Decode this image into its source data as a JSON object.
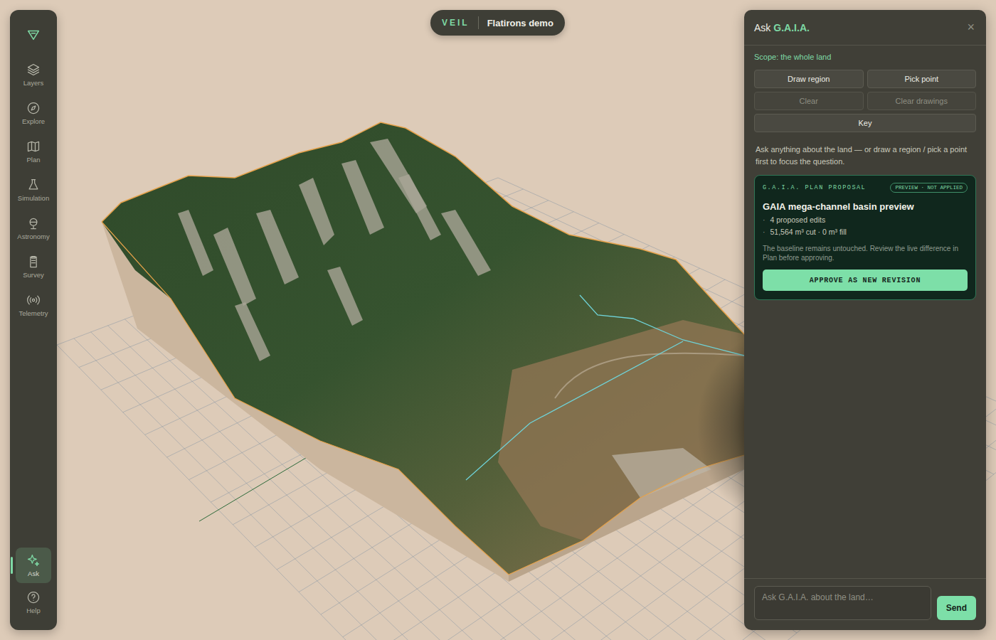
{
  "header": {
    "brand": "VEIL",
    "title": "Flatirons demo"
  },
  "sidebar": {
    "items": [
      {
        "label": "Layers",
        "selected": false
      },
      {
        "label": "Explore",
        "selected": false
      },
      {
        "label": "Plan",
        "selected": false
      },
      {
        "label": "Simulation",
        "selected": false
      },
      {
        "label": "Astronomy",
        "selected": false
      },
      {
        "label": "Survey",
        "selected": false
      },
      {
        "label": "Telemetry",
        "selected": false
      },
      {
        "label": "Ask",
        "selected": true
      },
      {
        "label": "Help",
        "selected": false
      }
    ]
  },
  "panel": {
    "title": "Ask",
    "title_highlight": "G.A.I.A.",
    "close": "×",
    "scope": "Scope: the whole land",
    "tools": [
      {
        "label": "Draw region",
        "disabled": false
      },
      {
        "label": "Pick point",
        "disabled": false
      },
      {
        "label": "Clear",
        "disabled": true
      },
      {
        "label": "Clear drawings",
        "disabled": true
      },
      {
        "label": "Key",
        "disabled": false
      }
    ],
    "hint": "Ask anything about the land — or draw a region / pick a point first to focus the question.",
    "proposal": {
      "label": "G.A.I.A. PLAN PROPOSAL",
      "badge": "PREVIEW · NOT APPLIED",
      "title": "GAIA mega-channel basin preview",
      "bullets": [
        {
          "mark": "·",
          "text": "4 proposed edits"
        },
        {
          "mark": "·",
          "text": "51,564 m³ cut · 0 m³ fill"
        }
      ],
      "note": "The baseline remains untouched. Review the live difference in Plan before approving.",
      "approve": "APPROVE AS NEW REVISION"
    },
    "input": {
      "placeholder": "Ask G.A.I.A. about the land…"
    },
    "send": "Send"
  }
}
